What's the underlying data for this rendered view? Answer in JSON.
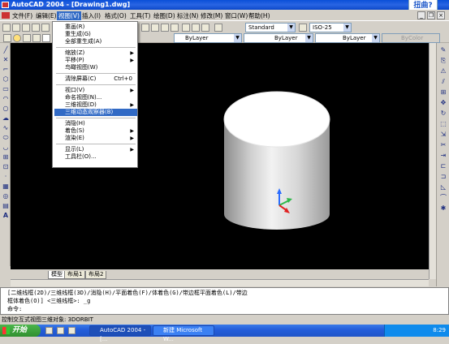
{
  "window": {
    "title": "AutoCAD 2004 - [Drawing1.dwg]",
    "watermark": "扭曲?"
  },
  "menubar": {
    "items": [
      "文件(F)",
      "编辑(E)",
      "视图(V)",
      "插入(I)",
      "格式(O)",
      "工具(T)",
      "绘图(D)",
      "标注(N)",
      "修改(M)",
      "窗口(W)",
      "帮助(H)"
    ],
    "active_index": 2
  },
  "toolbar": {
    "text_style": "Standard",
    "dim_style": "ISO-25",
    "color": "ByLayer",
    "linetype": "ByLayer",
    "lineweight": "ByLayer",
    "plot_style": "ByColor"
  },
  "view_menu": {
    "items": [
      {
        "label": "重画(R)",
        "shortcut": ""
      },
      {
        "label": "重生成(G)",
        "shortcut": ""
      },
      {
        "label": "全部重生成(A)",
        "shortcut": ""
      },
      {
        "sep": true
      },
      {
        "label": "缩放(Z)",
        "submenu": true
      },
      {
        "label": "平移(P)",
        "submenu": true
      },
      {
        "label": "鸟瞰视图(W)",
        "shortcut": ""
      },
      {
        "sep": true
      },
      {
        "label": "清除屏幕(C)",
        "shortcut": "Ctrl+0"
      },
      {
        "sep": true
      },
      {
        "label": "视口(V)",
        "submenu": true
      },
      {
        "label": "命名视图(N)...",
        "shortcut": ""
      },
      {
        "label": "三维视图(D)",
        "submenu": true
      },
      {
        "label": "三维动态观察器(B)",
        "shortcut": "",
        "highlighted": true
      },
      {
        "sep": true
      },
      {
        "label": "消隐(H)",
        "shortcut": ""
      },
      {
        "label": "着色(S)",
        "submenu": true
      },
      {
        "label": "渲染(E)",
        "submenu": true
      },
      {
        "sep": true
      },
      {
        "label": "显示(L)",
        "submenu": true
      },
      {
        "label": "工具栏(O)...",
        "shortcut": ""
      }
    ]
  },
  "layout_tabs": [
    "模型",
    "布局1",
    "布局2"
  ],
  "command": {
    "lines": [
      "[二维线框(2D)/三维线框(3D)/消隐(H)/平面着色(F)/体着色(G)/带边框平面着色(L)/带边",
      "框体着色(O)] <三维线框>: _g",
      "命令:"
    ]
  },
  "status_text": "控制交互式视图三维对象:  3DORBIT",
  "taskbar": {
    "start_label": "开始",
    "tasks": [
      "AutoCAD 2004 - [...",
      "新建 Microsoft W..."
    ],
    "clock": "8:29"
  },
  "colors": {
    "canvas": "#000000",
    "highlight": "#316ac5",
    "titlebar": "#0a4fd8"
  }
}
